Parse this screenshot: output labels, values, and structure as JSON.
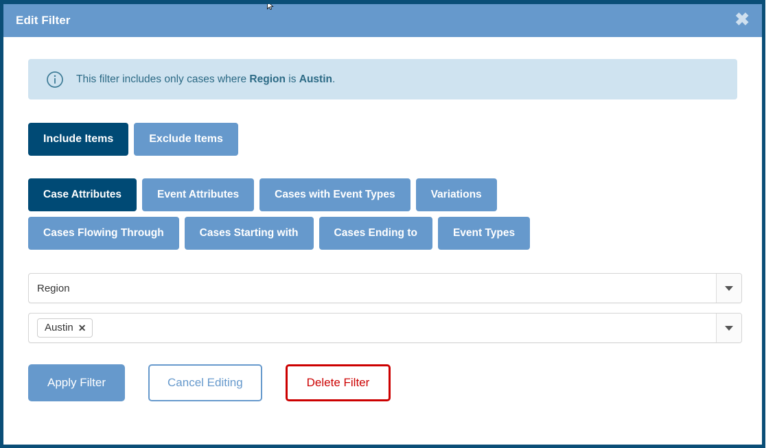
{
  "dialog": {
    "title": "Edit Filter",
    "close_label": "✖"
  },
  "banner": {
    "icon": "info-circle-icon",
    "text_prefix": "This filter includes only cases where ",
    "attribute": "Region",
    "text_middle": " is ",
    "value": "Austin",
    "text_suffix": "."
  },
  "mode_buttons": [
    {
      "label": "Include Items",
      "active": true
    },
    {
      "label": "Exclude Items",
      "active": false
    }
  ],
  "tabs": [
    {
      "label": "Case Attributes",
      "active": true
    },
    {
      "label": "Event Attributes",
      "active": false
    },
    {
      "label": "Cases with Event Types",
      "active": false
    },
    {
      "label": "Variations",
      "active": false
    },
    {
      "label": "Cases Flowing Through",
      "active": false
    },
    {
      "label": "Cases Starting with",
      "active": false
    },
    {
      "label": "Cases Ending to",
      "active": false
    },
    {
      "label": "Event Types",
      "active": false
    }
  ],
  "attribute_select": {
    "value": "Region",
    "caret": "chevron-down-icon"
  },
  "value_select": {
    "chips": [
      {
        "label": "Austin",
        "remove": "✕"
      }
    ],
    "caret": "chevron-down-icon"
  },
  "actions": {
    "apply_label": "Apply Filter",
    "cancel_label": "Cancel Editing",
    "delete_label": "Delete Filter"
  },
  "colors": {
    "title_bar": "#6699cc",
    "dialog_border": "#0a4e77",
    "active_tab": "#004a75",
    "inactive_tab": "#6699cc",
    "banner_bg": "#cfe3f0",
    "banner_text": "#2c6a85",
    "danger": "#cc0000"
  }
}
